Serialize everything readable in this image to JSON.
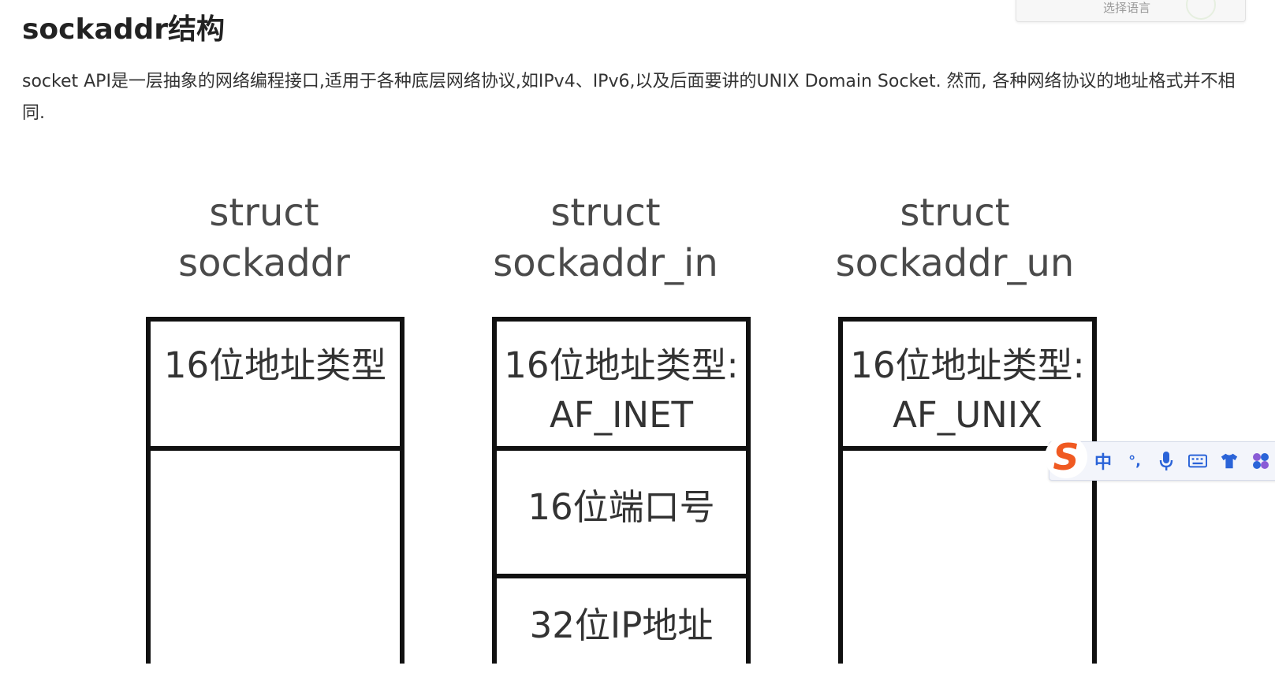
{
  "header": {
    "title": "sockaddr结构",
    "language_selector": "选择语言"
  },
  "intro": {
    "text": "socket API是一层抽象的网络编程接口,适用于各种底层网络协议,如IPv4、IPv6,以及后面要讲的UNIX Domain Socket. 然而, 各种网络协议的地址格式并不相同."
  },
  "diagram": {
    "structs": [
      {
        "heading": [
          "struct",
          "sockaddr"
        ],
        "cells": [
          [
            "16位地址类型"
          ],
          []
        ]
      },
      {
        "heading": [
          "struct",
          "sockaddr_in"
        ],
        "cells": [
          [
            "16位地址类型:",
            "AF_INET"
          ],
          [
            "16位端口号"
          ],
          [
            "32位IP地址"
          ]
        ]
      },
      {
        "heading": [
          "struct",
          "sockaddr_un"
        ],
        "cells": [
          [
            "16位地址类型:",
            "AF_UNIX"
          ],
          []
        ]
      }
    ]
  },
  "ime_toolbar": {
    "logo": "S",
    "mode": "中",
    "punct": "°,",
    "icons": [
      "microphone-icon",
      "keyboard-icon",
      "skin-shirt-icon",
      "toolbox-grid-icon"
    ],
    "colors": {
      "logo": "#f05a22",
      "icons": "#2b64d8"
    }
  }
}
